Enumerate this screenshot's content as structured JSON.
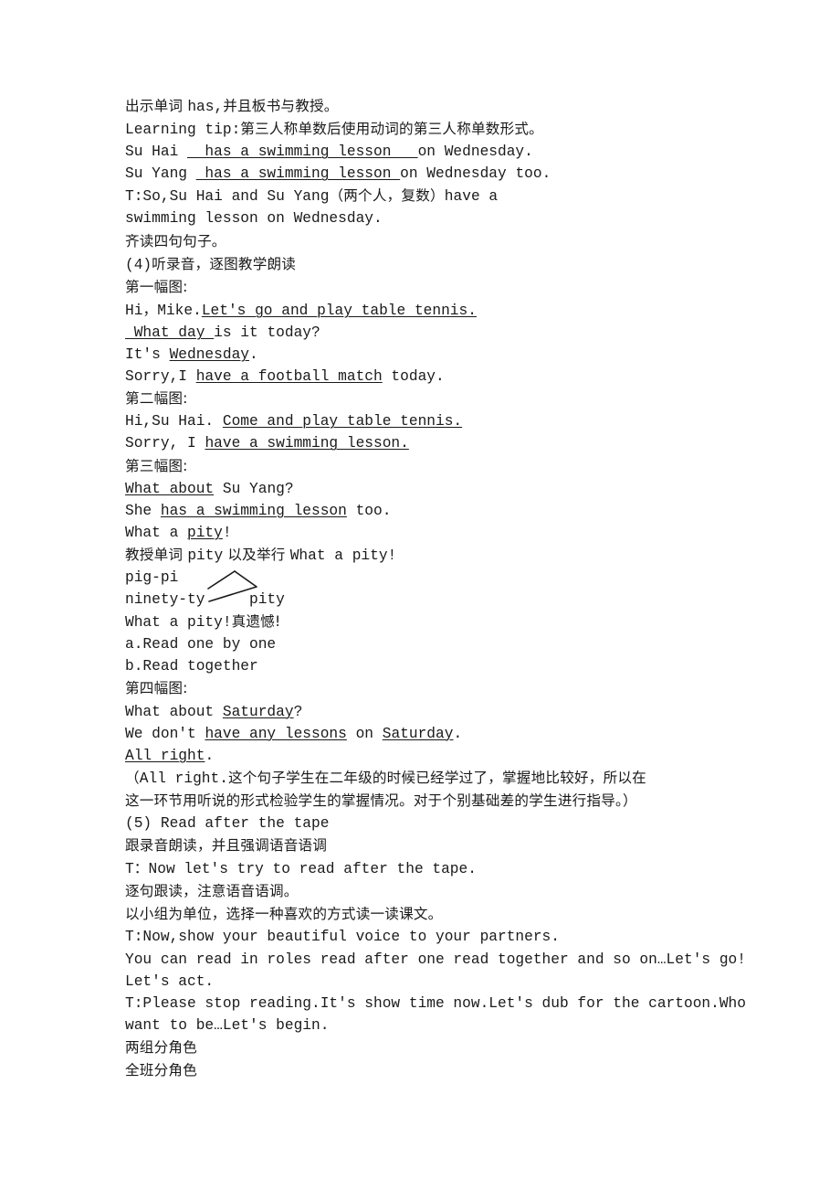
{
  "document": {
    "page_background": "#ffffff",
    "text_color": "#1a1a1a",
    "lines": [
      {
        "id": "l01",
        "text": "出示单词 has,并且板书与教授。"
      },
      {
        "id": "l02",
        "text": "Learning tip:第三人称单数后使用动词的第三人称单数形式。"
      },
      {
        "id": "l03",
        "text": "Su Hai  has a swimming lesson   on Wednesday."
      },
      {
        "id": "l04",
        "text": "Su Yang  has a swimming lesson on Wednesday too."
      },
      {
        "id": "l05",
        "text": "T:So,Su Hai and Su Yang（两个人，复数）have a"
      },
      {
        "id": "l06",
        "text": "swimming lesson on Wednesday."
      },
      {
        "id": "l07",
        "text": "齐读四句句子。"
      },
      {
        "id": "l08",
        "text": "(4)听录音，逐图教学朗读"
      },
      {
        "id": "l09",
        "text": "第一幅图:"
      },
      {
        "id": "l10",
        "text": "Hi，Mike.Let's go and play table tennis."
      },
      {
        "id": "l11",
        "text": " What day is it today?"
      },
      {
        "id": "l12",
        "text": "It's Wednesday."
      },
      {
        "id": "l13",
        "text": "Sorry,I have a football match today."
      },
      {
        "id": "l14",
        "text": "第二幅图:"
      },
      {
        "id": "l15",
        "text": "Hi,Su Hai. Come and play table tennis."
      },
      {
        "id": "l16",
        "text": "Sorry, I have a swimming lesson."
      },
      {
        "id": "l17",
        "text": "第三幅图:"
      },
      {
        "id": "l18",
        "text": "What about Su Yang?"
      },
      {
        "id": "l19",
        "text": "She has a swimming lesson too."
      },
      {
        "id": "l20",
        "text": "What a pity!"
      },
      {
        "id": "l21",
        "text": "教授单词 pity 以及举行 What a pity!"
      },
      {
        "id": "l22",
        "text": "pig-pi"
      },
      {
        "id": "l23",
        "text": "ninety-ty     pity"
      },
      {
        "id": "l24",
        "text": "What a pity!真遗憾!"
      },
      {
        "id": "l25",
        "text": "a.Read one by one"
      },
      {
        "id": "l26",
        "text": "b.Read together"
      },
      {
        "id": "l27",
        "text": "第四幅图:"
      },
      {
        "id": "l28",
        "text": "What about Saturday?"
      },
      {
        "id": "l29",
        "text": "We don't have any lessons on Saturday."
      },
      {
        "id": "l30",
        "text": "All right."
      },
      {
        "id": "l31",
        "text": "（All right.这个句子学生在二年级的时候已经学过了，掌握地比较好，所以在"
      },
      {
        "id": "l32",
        "text": "这一环节用听说的形式检验学生的掌握情况。对于个别基础差的学生进行指导。）"
      },
      {
        "id": "l33",
        "text": "(5) Read after the tape"
      },
      {
        "id": "l34",
        "text": "跟录音朗读，并且强调语音语调"
      },
      {
        "id": "l35",
        "text": "T: Now let's try to read after the tape."
      },
      {
        "id": "l36",
        "text": "逐句跟读，注意语音语调。"
      },
      {
        "id": "l37",
        "text": "以小组为单位，选择一种喜欢的方式读一读课文。"
      },
      {
        "id": "l38",
        "text": "T:Now,show your beautiful voice to your partners."
      },
      {
        "id": "l39",
        "text": "You can read in roles read after one read together and so on…Let's go!"
      },
      {
        "id": "l40",
        "text": "Let's act."
      },
      {
        "id": "l41",
        "text": "T:Please stop reading.It's show time now.Let's dub for the cartoon.Who"
      },
      {
        "id": "l42",
        "text": "want to be…Let's begin."
      },
      {
        "id": "l43",
        "text": "两组分角色"
      },
      {
        "id": "l44",
        "text": "全班分角色"
      }
    ],
    "segments": {
      "l01": [
        {
          "t": "出示单词 ",
          "cn": true
        },
        {
          "t": "has"
        },
        {
          "t": ",",
          "cn": false
        },
        {
          "t": "并且板书与教授。",
          "cn": true
        }
      ],
      "l02": [
        {
          "t": "Learning tip:"
        },
        {
          "t": "第三人称单数后使用动词的第三人称单数形式。",
          "cn": true
        }
      ],
      "l03": [
        {
          "t": "Su Hai "
        },
        {
          "t": "  has a swimming lesson   ",
          "u": true
        },
        {
          "t": "on Wednesday."
        }
      ],
      "l04": [
        {
          "t": "Su Yang "
        },
        {
          "t": " has a swimming lesson ",
          "u": true
        },
        {
          "t": "on Wednesday too."
        }
      ],
      "l05": [
        {
          "t": "T:So,Su Hai and Su Yang"
        },
        {
          "t": "（两个人，复数）",
          "cn": true
        },
        {
          "t": "have a"
        }
      ],
      "l06": [
        {
          "t": "swimming lesson on Wednesday."
        }
      ],
      "l07": [
        {
          "t": "齐读四句句子。",
          "cn": true
        }
      ],
      "l08": [
        {
          "t": "(4)"
        },
        {
          "t": "听录音，逐图教学朗读",
          "cn": true
        }
      ],
      "l09": [
        {
          "t": "第一幅图:",
          "cn": true
        }
      ],
      "l10": [
        {
          "t": "Hi"
        },
        {
          "t": "，",
          "cn": true
        },
        {
          "t": "Mike."
        },
        {
          "t": "Let's go and play table tennis.",
          "u": true
        }
      ],
      "l11": [
        {
          "t": " What day ",
          "u": true
        },
        {
          "t": "is it today?"
        }
      ],
      "l12": [
        {
          "t": "It's "
        },
        {
          "t": "Wednesday",
          "u": true
        },
        {
          "t": "."
        }
      ],
      "l13": [
        {
          "t": "Sorry,I "
        },
        {
          "t": "have a football match",
          "u": true
        },
        {
          "t": " today."
        }
      ],
      "l14": [
        {
          "t": "第二幅图:",
          "cn": true
        }
      ],
      "l15": [
        {
          "t": "Hi,Su Hai. "
        },
        {
          "t": "Come and play table tennis.",
          "u": true
        }
      ],
      "l16": [
        {
          "t": "Sorry, I "
        },
        {
          "t": "have a swimming lesson.",
          "u": true
        }
      ],
      "l17": [
        {
          "t": "第三幅图:",
          "cn": true
        }
      ],
      "l18": [
        {
          "t": "What about",
          "u": true
        },
        {
          "t": " Su Yang?"
        }
      ],
      "l19": [
        {
          "t": "She "
        },
        {
          "t": "has a swimming lesson",
          "u": true
        },
        {
          "t": " too."
        }
      ],
      "l20": [
        {
          "t": "What a "
        },
        {
          "t": "pity",
          "u": true
        },
        {
          "t": "!"
        }
      ],
      "l21": [
        {
          "t": "教授单词 ",
          "cn": true
        },
        {
          "t": "pity"
        },
        {
          "t": " 以及举行 ",
          "cn": true
        },
        {
          "t": "What a pity!"
        }
      ],
      "l22": [
        {
          "t": "pig-pi"
        }
      ],
      "l23": [
        {
          "t": "ninety-ty     pity"
        }
      ],
      "l24": [
        {
          "t": "What a pity!"
        },
        {
          "t": "真遗憾!",
          "cn": true
        }
      ],
      "l25": [
        {
          "t": "a.Read one by one"
        }
      ],
      "l26": [
        {
          "t": "b.Read together"
        }
      ],
      "l27": [
        {
          "t": "第四幅图:",
          "cn": true
        }
      ],
      "l28": [
        {
          "t": "What about "
        },
        {
          "t": "Saturday",
          "u": true
        },
        {
          "t": "?"
        }
      ],
      "l29": [
        {
          "t": "We don't "
        },
        {
          "t": "have any lessons",
          "u": true
        },
        {
          "t": " on "
        },
        {
          "t": "Saturday",
          "u": true
        },
        {
          "t": "."
        }
      ],
      "l30": [
        {
          "t": "All right",
          "u": true
        },
        {
          "t": "."
        }
      ],
      "l31": [
        {
          "t": "（",
          "cn": true
        },
        {
          "t": "All right."
        },
        {
          "t": "这个句子学生在二年级的时候已经学过了，掌握地比较好，所以在",
          "cn": true
        }
      ],
      "l32": [
        {
          "t": "这一环节用听说的形式检验学生的掌握情况。对于个别基础差的学生进行指导。）",
          "cn": true
        }
      ],
      "l33": [
        {
          "t": "(5) Read after the tape"
        }
      ],
      "l34": [
        {
          "t": "跟录音朗读，并且强调语音语调",
          "cn": true
        }
      ],
      "l35": [
        {
          "t": "T"
        },
        {
          "t": "：",
          "cn": true
        },
        {
          "t": "Now let's try to read after the tape."
        }
      ],
      "l36": [
        {
          "t": "逐句跟读，注意语音语调。",
          "cn": true
        }
      ],
      "l37": [
        {
          "t": "以小组为单位，选择一种喜欢的方式读一读课文。",
          "cn": true
        }
      ],
      "l38": [
        {
          "t": "T:Now,show your beautiful voice to your partners."
        }
      ],
      "l39": [
        {
          "t": "You can read in roles read after one read together and so on…Let's go!"
        }
      ],
      "l40": [
        {
          "t": "Let's act."
        }
      ],
      "l41": [
        {
          "t": "T:Please stop reading.It's show time now.Let's dub for the cartoon.Who"
        }
      ],
      "l42": [
        {
          "t": "want to be…Let's begin."
        }
      ],
      "l43": [
        {
          "t": "两组分角色",
          "cn": true
        }
      ],
      "l44": [
        {
          "t": "全班分角色",
          "cn": true
        }
      ]
    },
    "diagram": {
      "name": "pity-bracket",
      "description": "two lines converging to a point, linking pig-pi and ninety-ty to pity",
      "stroke_color": "#1a1a1a"
    }
  }
}
